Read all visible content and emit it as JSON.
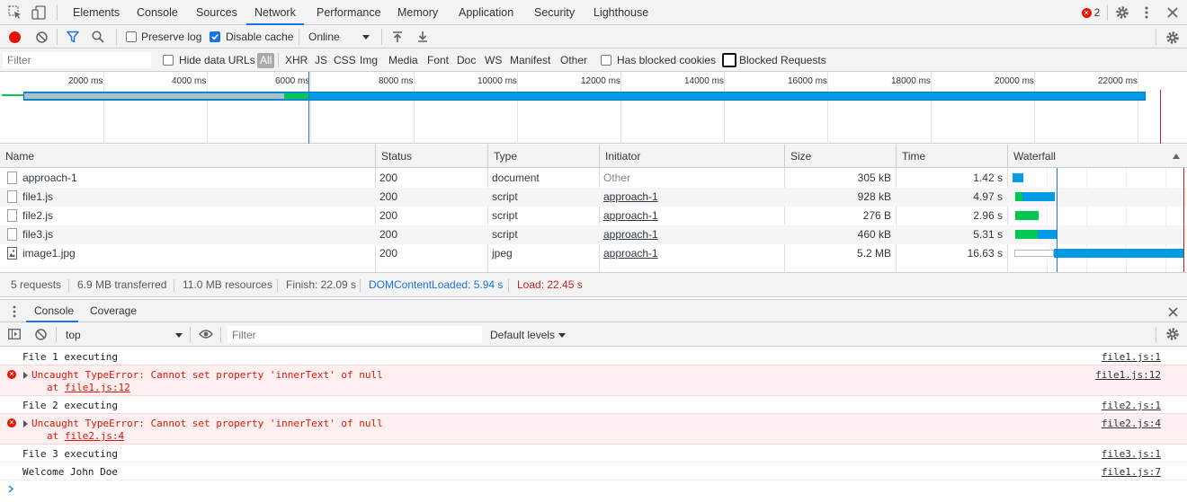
{
  "top_tabs": [
    "Elements",
    "Console",
    "Sources",
    "Network",
    "Performance",
    "Memory",
    "Application",
    "Security",
    "Lighthouse"
  ],
  "active_tab": "Network",
  "error_count": "2",
  "net_toolbar": {
    "preserve_log": "Preserve log",
    "disable_cache": "Disable cache",
    "throttle": "Online"
  },
  "filter_bar": {
    "placeholder": "Filter",
    "hide_data_urls": "Hide data URLs",
    "types": [
      "All",
      "XHR",
      "JS",
      "CSS",
      "Img",
      "Media",
      "Font",
      "Doc",
      "WS",
      "Manifest",
      "Other"
    ],
    "has_blocked_cookies": "Has blocked cookies",
    "blocked_requests": "Blocked Requests"
  },
  "overview_ticks": [
    "2000 ms",
    "4000 ms",
    "6000 ms",
    "8000 ms",
    "10000 ms",
    "12000 ms",
    "14000 ms",
    "16000 ms",
    "18000 ms",
    "20000 ms",
    "22000 ms"
  ],
  "table": {
    "columns": [
      "Name",
      "Status",
      "Type",
      "Initiator",
      "Size",
      "Time",
      "Waterfall"
    ],
    "rows": [
      {
        "name": "approach-1",
        "status": "200",
        "type": "document",
        "initiator": "Other",
        "size": "305 kB",
        "time": "1.42 s",
        "icon": "document-icon"
      },
      {
        "name": "file1.js",
        "status": "200",
        "type": "script",
        "initiator": "approach-1",
        "size": "928 kB",
        "time": "4.97 s",
        "icon": "document-icon"
      },
      {
        "name": "file2.js",
        "status": "200",
        "type": "script",
        "initiator": "approach-1",
        "size": "276 B",
        "time": "2.96 s",
        "icon": "document-icon"
      },
      {
        "name": "file3.js",
        "status": "200",
        "type": "script",
        "initiator": "approach-1",
        "size": "460 kB",
        "time": "5.31 s",
        "icon": "document-icon"
      },
      {
        "name": "image1.jpg",
        "status": "200",
        "type": "jpeg",
        "initiator": "approach-1",
        "size": "5.2 MB",
        "time": "16.63 s",
        "icon": "image-icon"
      }
    ]
  },
  "summary": {
    "requests": "5 requests",
    "transferred": "6.9 MB transferred",
    "resources": "11.0 MB resources",
    "finish": "Finish: 22.09 s",
    "dcl": "DOMContentLoaded: 5.94 s",
    "load": "Load: 22.45 s"
  },
  "drawer_tabs": [
    "Console",
    "Coverage"
  ],
  "console_toolbar": {
    "context": "top",
    "filter_placeholder": "Filter",
    "levels": "Default levels"
  },
  "console_messages": [
    {
      "text": "File 1 executing",
      "src": "file1.js:1",
      "level": "log"
    },
    {
      "text": "Uncaught TypeError: Cannot set property 'innerText' of null",
      "at": "at ",
      "at_link": "file1.js:12",
      "src": "file1.js:12",
      "level": "error"
    },
    {
      "text": "File 2 executing",
      "src": "file2.js:1",
      "level": "log"
    },
    {
      "text": "Uncaught TypeError: Cannot set property 'innerText' of null",
      "at": "at ",
      "at_link": "file2.js:4",
      "src": "file2.js:4",
      "level": "error"
    },
    {
      "text": "File 3 executing",
      "src": "file3.js:1",
      "level": "log"
    },
    {
      "text": "Welcome John Doe",
      "src": "file1.js:7",
      "level": "log"
    }
  ],
  "colors": {
    "accent": "#1a73e8",
    "record": "#e51400",
    "waiting": "#00c853",
    "download": "#039be5",
    "dcl": "#1a73e8",
    "load": "#c5221f"
  }
}
